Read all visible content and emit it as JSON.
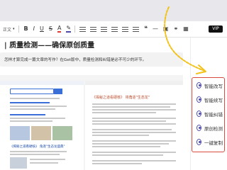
{
  "toolbar": {
    "body_label": "正文",
    "bold": "B",
    "italic": "I",
    "underline": "U",
    "strike": "S",
    "font_color_icon": "font-color-icon",
    "highlight_icon": "highlight-icon",
    "vip_badge": "VIP"
  },
  "article": {
    "title": "| 质量检测——确保原创质量",
    "quote": "怎样才算完成一篇文章的写作？在Get版中，质量检测和纠错是必不可少的环节。"
  },
  "preview": {
    "left_headline": "",
    "right_headline": "《揭秘之道看硬核》 将角逐\"生态龙\"",
    "left_caption": "《揭秘之道看硬核》 角逐\"生态龙盛典\""
  },
  "sidebar_tools": [
    {
      "label": "智能改写",
      "icon": "rewrite-icon"
    },
    {
      "label": "智能续写",
      "icon": "continue-icon"
    },
    {
      "label": "智能纠错",
      "icon": "correct-icon"
    },
    {
      "label": "原创检测",
      "icon": "check-icon"
    },
    {
      "label": "一键复制",
      "icon": "copy-icon"
    }
  ],
  "colors": {
    "accent": "#4b4aa8",
    "highlight_box": "#d94a3f",
    "arrow": "#f2c21b"
  }
}
